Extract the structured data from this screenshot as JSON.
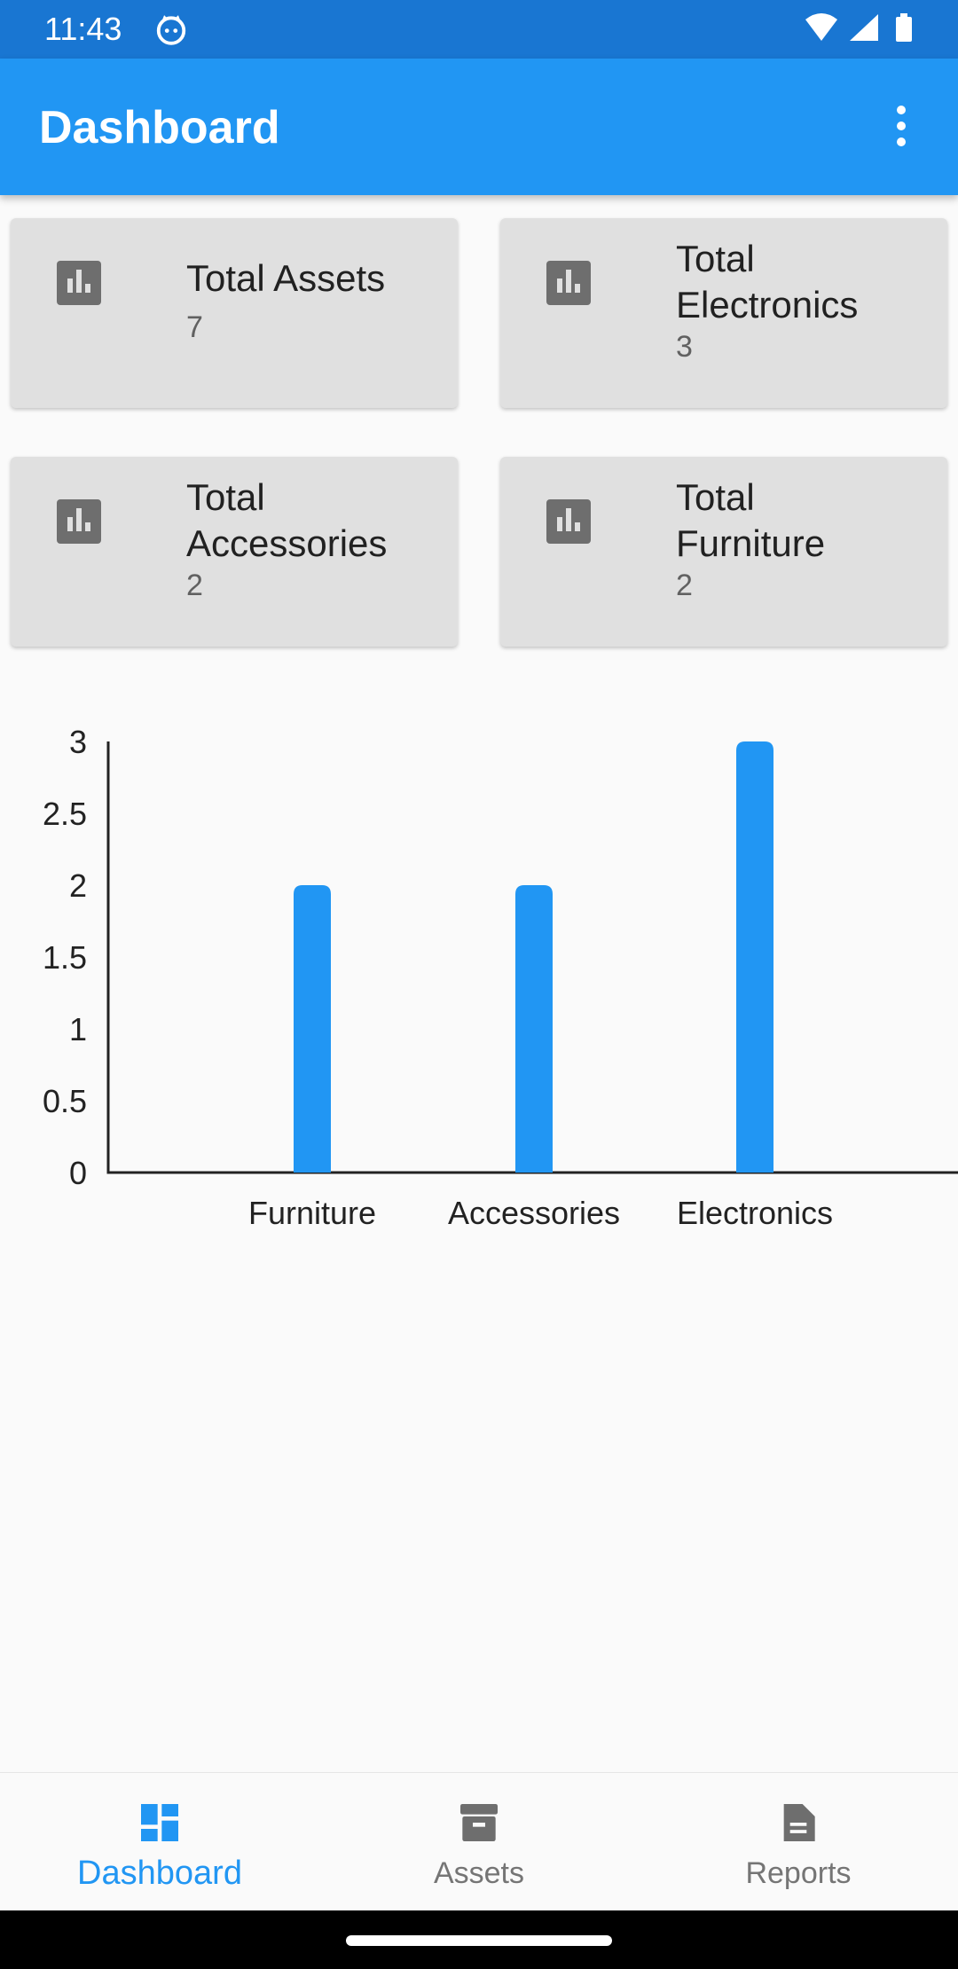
{
  "status_bar": {
    "time": "11:43"
  },
  "app_bar": {
    "title": "Dashboard"
  },
  "cards": [
    {
      "label": "Total Assets",
      "value": "7"
    },
    {
      "label": "Total Electronics",
      "value": "3"
    },
    {
      "label": "Total Accessories",
      "value": "2"
    },
    {
      "label": "Total Furniture",
      "value": "2"
    }
  ],
  "chart_data": {
    "type": "bar",
    "categories": [
      "Furniture",
      "Accessories",
      "Electronics"
    ],
    "values": [
      2,
      2,
      3
    ],
    "title": "",
    "xlabel": "",
    "ylabel": "",
    "ylim": [
      0,
      3
    ],
    "yticks": [
      "0",
      "0.5",
      "1",
      "1.5",
      "2",
      "2.5",
      "3"
    ],
    "bar_color": "#2196f3",
    "grid": false
  },
  "bottom_nav": {
    "items": [
      {
        "label": "Dashboard",
        "icon": "dashboard-icon",
        "active": true
      },
      {
        "label": "Assets",
        "icon": "archive-icon",
        "active": false
      },
      {
        "label": "Reports",
        "icon": "document-icon",
        "active": false
      }
    ]
  },
  "colors": {
    "primary": "#2196f3",
    "primary_dark": "#1976d2",
    "card_bg": "#e0e0e0"
  }
}
